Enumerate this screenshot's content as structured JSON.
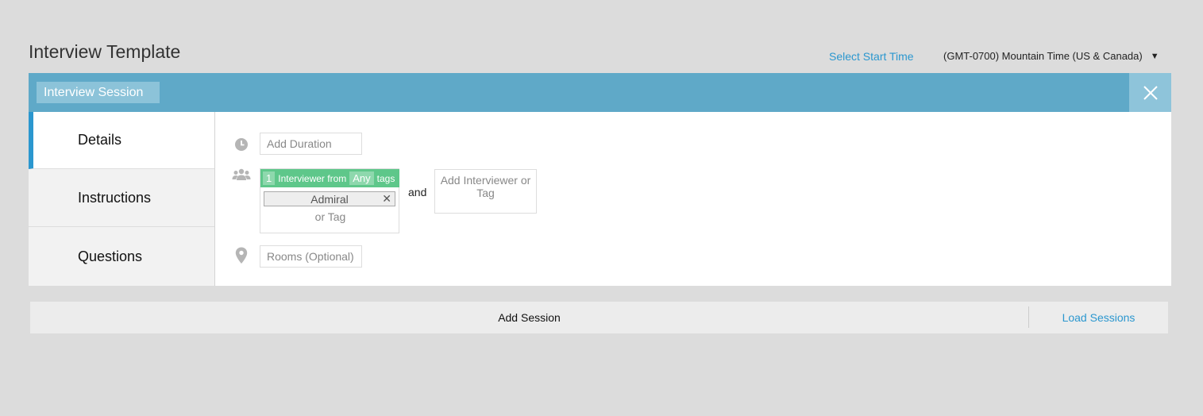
{
  "header": {
    "title": "Interview Template",
    "start_time_label": "Select Start Time",
    "timezone": "(GMT-0700) Mountain Time (US & Canada)"
  },
  "session": {
    "name": "Interview Session",
    "tabs": [
      {
        "label": "Details",
        "active": true
      },
      {
        "label": "Instructions",
        "active": false
      },
      {
        "label": "Questions",
        "active": false
      }
    ],
    "duration_placeholder": "Add Duration",
    "interviewer": {
      "count": "1",
      "from_label": "Interviewer from",
      "any_label": "Any",
      "tags_label": "tags",
      "tag": "Admiral",
      "or_tag_placeholder": "or Tag"
    },
    "and_label": "and",
    "add_interviewer_label": "Add Interviewer or Tag",
    "rooms_placeholder": "Rooms (Optional)"
  },
  "footer": {
    "add_session": "Add Session",
    "load_sessions": "Load Sessions"
  },
  "colors": {
    "accent": "#2b97cf",
    "header_bar": "#5fa9c8",
    "interviewer_bar": "#5ec78a"
  },
  "icons": [
    "clock-icon",
    "people-icon",
    "location-pin-icon",
    "close-icon",
    "caret-down-icon",
    "remove-tag-icon"
  ]
}
